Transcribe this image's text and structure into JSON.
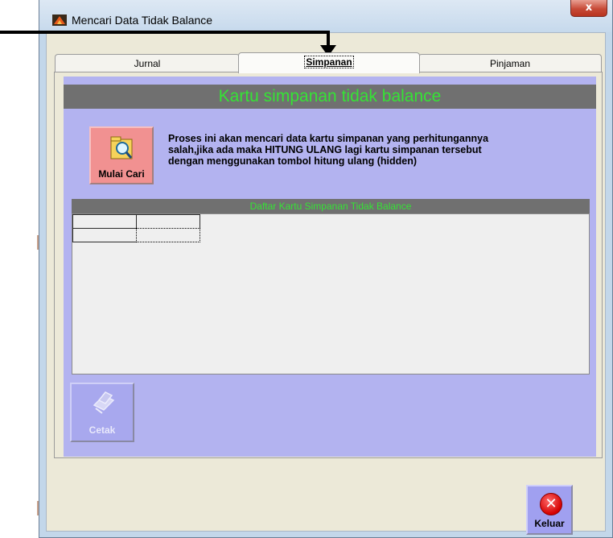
{
  "window": {
    "title": "Mencari Data Tidak Balance",
    "close_label": "x"
  },
  "tabs": [
    {
      "label": "Jurnal",
      "active": false
    },
    {
      "label": "Simpanan",
      "active": true
    },
    {
      "label": "Pinjaman",
      "active": false
    }
  ],
  "panel": {
    "header": "Kartu simpanan tidak balance",
    "search_button_label": "Mulai Cari",
    "info_lines": [
      "Proses ini akan mencari data kartu simpanan yang perhitungannya",
      "salah,jika ada maka HITUNG ULANG lagi kartu simpanan tersebut",
      "dengan menggunakan tombol hitung ulang (hidden)"
    ],
    "list_header": "Daftar Kartu Simpanan Tidak Balance",
    "print_button_label": "Cetak"
  },
  "footer": {
    "exit_button_label": "Keluar"
  },
  "colors": {
    "panel_bg": "#b3b3f0",
    "header_bg": "#707070",
    "header_text": "#35e335",
    "search_button_bg": "#f19191"
  }
}
